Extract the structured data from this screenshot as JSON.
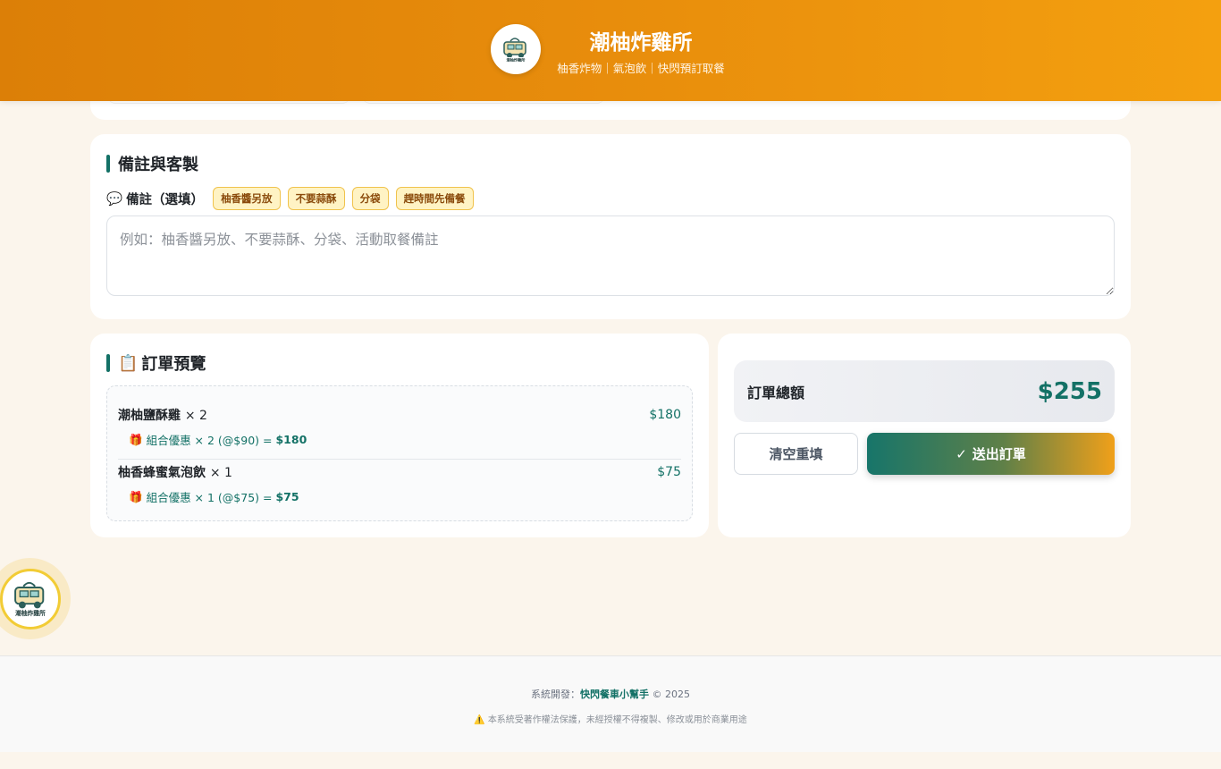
{
  "header": {
    "title": "潮柚炸雞所",
    "subtitle": "柚香炸物｜氣泡飲｜快閃預訂取餐",
    "logo_text": "潮柚炸雞所"
  },
  "notes": {
    "section_title": "備註與客製",
    "label": "備註（選填）",
    "label_icon": "💬",
    "chips": [
      "柚香醬另放",
      "不要蒜酥",
      "分袋",
      "趕時間先備餐"
    ],
    "placeholder": "例如：柚香醬另放、不要蒜酥、分袋、活動取餐備註",
    "value": ""
  },
  "preview": {
    "section_title": "訂單預覽",
    "title_icon": "📋",
    "items": [
      {
        "name": "潮柚鹽酥雞",
        "qty_text": "× 2",
        "price": "$180",
        "promo_icon": "🎁",
        "promo_text": "組合優惠 × 2 (@$90) =",
        "promo_total": "$180"
      },
      {
        "name": "柚香蜂蜜氣泡飲",
        "qty_text": "× 1",
        "price": "$75",
        "promo_icon": "🎁",
        "promo_text": "組合優惠 × 1 (@$75) =",
        "promo_total": "$75"
      }
    ]
  },
  "total": {
    "label": "訂單總額",
    "value": "$255",
    "clear_label": "清空重填",
    "submit_icon": "✓",
    "submit_label": "送出訂單"
  },
  "footer": {
    "dev_prefix": "系統開發：",
    "dev_name": "快閃餐車小幫手",
    "dev_suffix": "© 2025",
    "warning_icon": "⚠️",
    "warning_text": "本系統受著作權法保護，未經授權不得複製、修改或用於商業用途"
  },
  "colors": {
    "brand_orange": "#e88d0c",
    "brand_green": "#137166",
    "chip_bg": "#fff3c4"
  }
}
